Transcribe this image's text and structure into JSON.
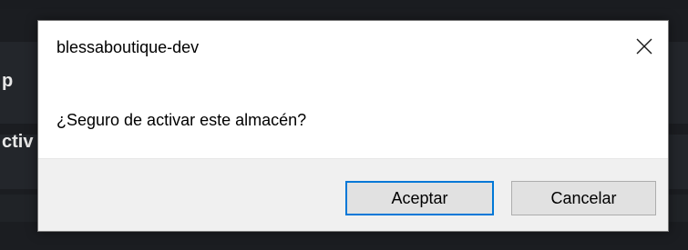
{
  "background": {
    "partial_text_1": "p",
    "partial_text_2": "ctiv"
  },
  "dialog": {
    "title": "blessaboutique-dev",
    "message": "¿Seguro de activar este almacén?",
    "close_icon": "close-icon",
    "buttons": {
      "accept_label": "Aceptar",
      "cancel_label": "Cancelar"
    }
  },
  "colors": {
    "primary_border": "#0078d7",
    "button_bg": "#e1e1e1",
    "footer_bg": "#f0f0f0",
    "page_bg": "#1b1d21"
  }
}
